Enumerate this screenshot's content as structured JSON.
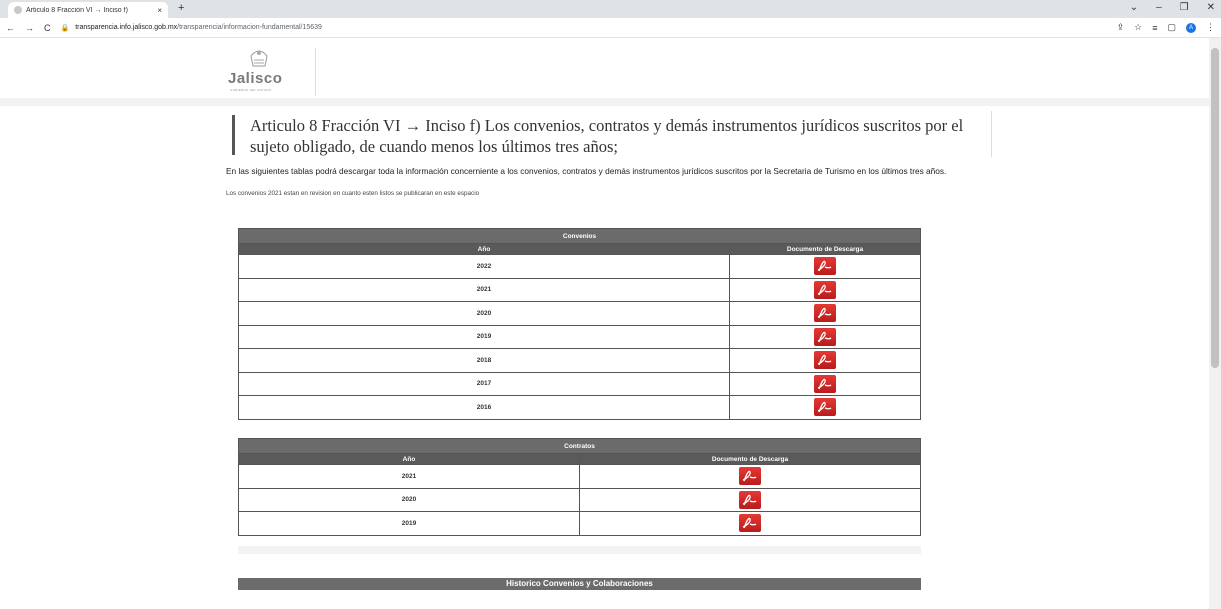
{
  "browser": {
    "tab_title": "Articulo 8 Fracción VI → Inciso f)",
    "tab_close": "×",
    "new_tab": "+",
    "url_host": "transparencia.info.jalisco.gob.mx",
    "url_path": "/transparencia/informacion-fundamental/15639",
    "profile_initial": "A"
  },
  "site": {
    "logo_word": "Jalisco",
    "logo_sub": "GOBIERNO DEL ESTADO"
  },
  "page": {
    "heading": "Articulo 8 Fracción VI → Inciso f) Los convenios, contratos y demás instrumentos jurídicos suscritos por el sujeto obligado, de cuando menos los últimos tres años;",
    "intro": "En las siguientes tablas podrá descargar  toda la información concerniente a los convenios, contratos y demás instrumentos jurídicos suscritos por la Secretaria de Turismo en los últimos tres años.",
    "note": "Los convenios 2021 estan en revision en cuanto esten listos se publicaran en este espacio"
  },
  "convenios": {
    "caption": "Convenios",
    "col_year": "Año",
    "col_doc": "Documento de Descarga",
    "rows": [
      "2022",
      "2021",
      "2020",
      "2019",
      "2018",
      "2017",
      "2016"
    ]
  },
  "contratos": {
    "caption": "Contratos",
    "col_year": "Año",
    "col_doc": "Documento de Descarga",
    "rows": [
      "2021",
      "2020",
      "2019"
    ]
  },
  "historico": {
    "caption": "Historico Convenios y Colaboraciones"
  },
  "colors": {
    "table_header": "#5a5a5a",
    "pdf_red": "#d32f2f"
  }
}
